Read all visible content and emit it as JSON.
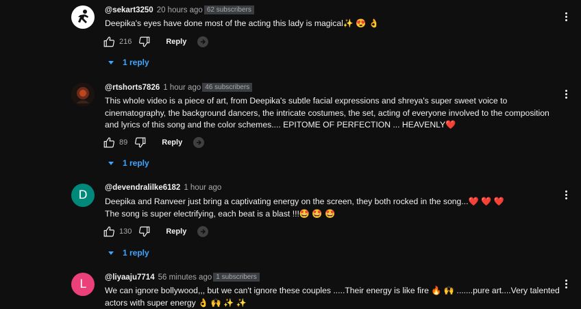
{
  "comments": [
    {
      "author": "@sekart3250",
      "time": "20 hours ago",
      "badge": "62 subscribers",
      "text_lines": [
        "Deepika's eyes have done most of the acting this lady is magical✨ 😍 👌"
      ],
      "likes": "216",
      "reply_label": "Reply",
      "replies_label": "1 reply",
      "avatar_letter": "",
      "avatar_color": "#ffffff"
    },
    {
      "author": "@rtshorts7826",
      "time": "1 hour ago",
      "badge": "46 subscribers",
      "text_lines": [
        "This whole video is a piece of art, from Deepika's subtle facial expressions and shreya's super sweet voice to",
        "cinematography, the background dancers, the intricate costumes, the set, acting of everyone involved to the composition",
        "and lyrics of this song and the color schemes.... EPITOME OF PERFECTION ... HEAVENLY❤️"
      ],
      "likes": "89",
      "reply_label": "Reply",
      "replies_label": "1 reply",
      "avatar_letter": "",
      "avatar_color": "#2a1a14"
    },
    {
      "author": "@devendralilke6182",
      "time": "1 hour ago",
      "badge": "",
      "text_lines": [
        "Deepika and Ranveer just bring a captivating energy on the screen, they both rocked in the song...❤️ ❤️ ❤️",
        "The song is super electrifying, each beat is a blast !!!🤩 🤩 🤩"
      ],
      "likes": "130",
      "reply_label": "Reply",
      "replies_label": "1 reply",
      "avatar_letter": "D",
      "avatar_color": "#00897b"
    },
    {
      "author": "@liyaaju7714",
      "time": "56 minutes ago",
      "badge": "1 subscribers",
      "text_lines": [
        "We  can ignore bollywood,,, but we can't ignore these couples .....Their energy is like fire 🔥 🙌 .......pure art....Very talented",
        "actors with super energy 👌 🙌 ✨ ✨"
      ],
      "likes": "",
      "reply_label": "",
      "replies_label": "",
      "avatar_letter": "L",
      "avatar_color": "#ec407a"
    }
  ]
}
